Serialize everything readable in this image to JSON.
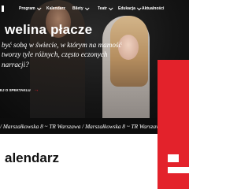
{
  "nav": {
    "items": [
      {
        "label": "Program",
        "has_dropdown": true
      },
      {
        "label": "Kalendarz",
        "has_dropdown": false
      },
      {
        "label": "Bilety",
        "has_dropdown": true
      },
      {
        "label": "Teatr",
        "has_dropdown": true
      },
      {
        "label": "Edukacja",
        "has_dropdown": true
      },
      {
        "label": "Aktualności",
        "has_dropdown": false
      }
    ]
  },
  "hero": {
    "title": "welina płacze",
    "description": "być sobą w świecie, w którym na mamość tworzy tyle różnych, często eczonych narracji?",
    "cta_label": "EJ O SPEKTAKLU",
    "cta_arrow": "→"
  },
  "ticker": {
    "text": "/ Marszałkowska 8 ~ TR Warszawa / Marszałkowska 8 ~ TR Warszawa / Marszałkowska 8 ~ TR Warszawa"
  },
  "section": {
    "title": "alendarz"
  },
  "colors": {
    "accent": "#e3222b",
    "band": "#0d0d0d",
    "text_light": "#ffffff",
    "text_dark": "#111111"
  }
}
